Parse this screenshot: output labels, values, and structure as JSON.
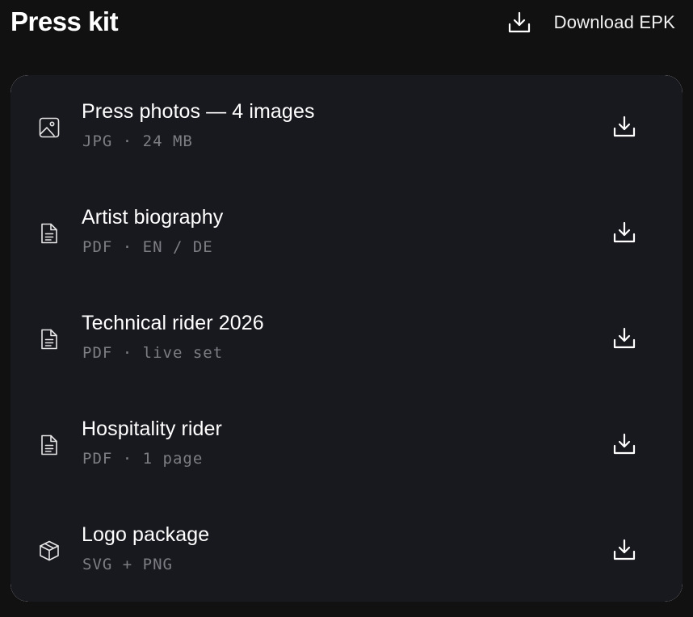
{
  "header": {
    "title": "Press kit",
    "download_label": "Download EPK",
    "download_icon": "download-icon"
  },
  "colors": {
    "background": "#111111",
    "panel": "#18181f",
    "text": "#ffffff",
    "meta_text": "#7d7d84"
  },
  "items": [
    {
      "name": "Press photos — 4 images",
      "meta": "JPG · 24 MB",
      "icon": "image-icon"
    },
    {
      "name": "Artist biography",
      "meta": "PDF · EN / DE",
      "icon": "document-icon"
    },
    {
      "name": "Technical rider 2026",
      "meta": "PDF · live set",
      "icon": "document-icon"
    },
    {
      "name": "Hospitality rider",
      "meta": "PDF · 1 page",
      "icon": "document-icon"
    },
    {
      "name": "Logo package",
      "meta": "SVG + PNG",
      "icon": "package-icon"
    }
  ]
}
